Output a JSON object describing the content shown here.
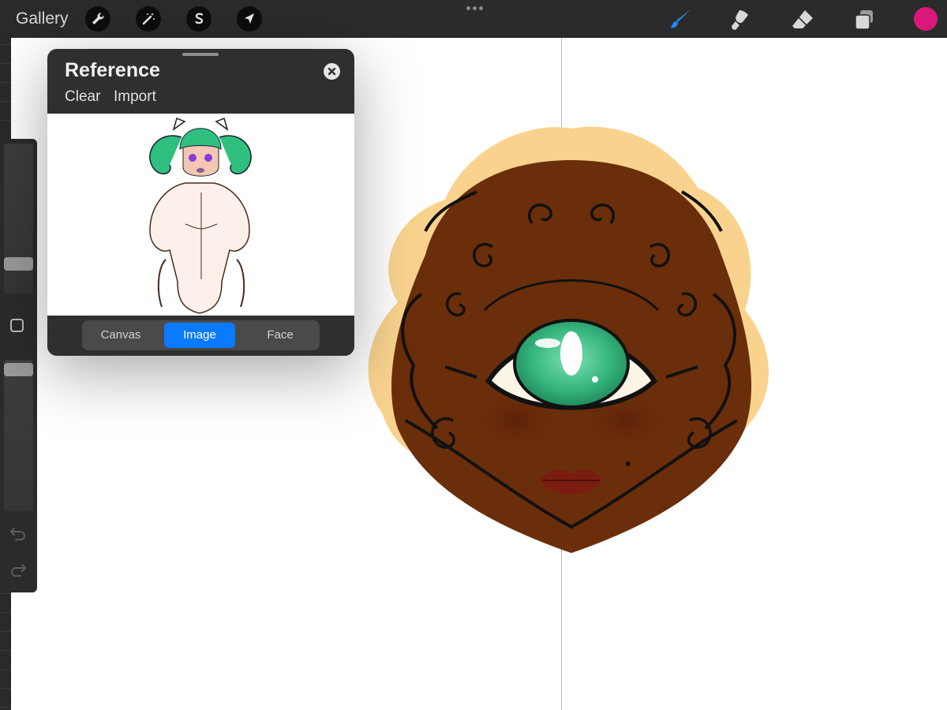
{
  "topbar": {
    "gallery_label": "Gallery",
    "tools": [
      "wrench-icon",
      "magic-wand-icon",
      "selection-s-icon",
      "transform-arrow-icon"
    ],
    "right_tools": [
      "brush-icon",
      "smudge-icon",
      "eraser-icon",
      "layers-icon"
    ],
    "active_tool": "brush",
    "current_color": "#d9197a"
  },
  "reference": {
    "title": "Reference",
    "clear_label": "Clear",
    "import_label": "Import",
    "segments": [
      "Canvas",
      "Image",
      "Face"
    ],
    "selected_segment": "Image"
  },
  "colors": {
    "accent": "#0a7aff",
    "skin": "#6b2e0a",
    "hair": "#f9d38e",
    "eye": "#3ec48e"
  }
}
